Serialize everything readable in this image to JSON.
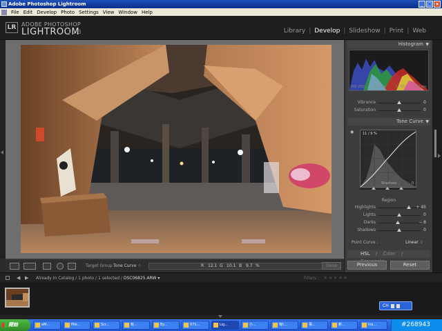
{
  "window": {
    "title": "Adobe Photoshop Lightroom"
  },
  "menu": [
    "File",
    "Edit",
    "Develop",
    "Photo",
    "Settings",
    "View",
    "Window",
    "Help"
  ],
  "identity": {
    "badge": "LR",
    "brand_top": "ADOBE PHOTOSHOP",
    "brand_main": "LIGHTROOM",
    "version": "1.3"
  },
  "modules": [
    {
      "label": "Library",
      "active": false
    },
    {
      "label": "Develop",
      "active": true
    },
    {
      "label": "Slideshow",
      "active": false
    },
    {
      "label": "Print",
      "active": false
    },
    {
      "label": "Web",
      "active": false
    }
  ],
  "panels": {
    "histogram": {
      "title": "Histogram",
      "iso": "ISO 200",
      "focal": "20 mm",
      "aperture": "f / 10",
      "shutter": "8.0 sec"
    },
    "presence": {
      "vibrance_label": "Vibrance",
      "vibrance_value": "0",
      "vibrance_level": 0.5,
      "saturation_label": "Saturation",
      "saturation_value": "0",
      "saturation_level": 0.5
    },
    "tone_curve": {
      "title": "Tone Curve",
      "readout": "11 / 9 %",
      "hover_region": "Shadows",
      "axis_min": "0",
      "region_label": "Region",
      "sliders": [
        {
          "label": "Highlights",
          "value": "+ 45",
          "level": 0.72
        },
        {
          "label": "Lights",
          "value": "0",
          "level": 0.5
        },
        {
          "label": "Darks",
          "value": "− 8",
          "level": 0.46
        },
        {
          "label": "Shadows",
          "value": "0",
          "level": 0.5
        }
      ],
      "point_curve_label": "Point Curve :",
      "point_curve_value": "Linear ♢"
    },
    "hsl": {
      "items": [
        "HSL",
        "Color",
        "Grayscale"
      ],
      "sep": "/"
    },
    "buttons": {
      "previous": "Previous",
      "reset": "Reset"
    }
  },
  "toolbar": {
    "target_group_label": "Target Group :",
    "target_group_value": "Tone Curve ♢",
    "r_label": "R",
    "r_value": "12.1",
    "g_label": "G",
    "g_value": "10.1",
    "b_label": "B",
    "b_value": "9.7",
    "pct": "%",
    "done": "Done"
  },
  "filmstrip": {
    "catalog": "Already In Catalog / 1 photo / 1 selected /",
    "filename": "DSC06825.ARW ▾",
    "filters": "Filters :",
    "stars": "★★★★★"
  },
  "langbar": {
    "code": "CH"
  },
  "taskbar": {
    "start": "開始",
    "tasks": [
      "aM...",
      "Pile...",
      "Scr...",
      "有...",
      "By...",
      "071...",
      "Lig...",
      "小...",
      "有t...",
      "事...",
      "新...",
      "Ins..."
    ],
    "active_index": 6,
    "tray_text": "#268943"
  }
}
